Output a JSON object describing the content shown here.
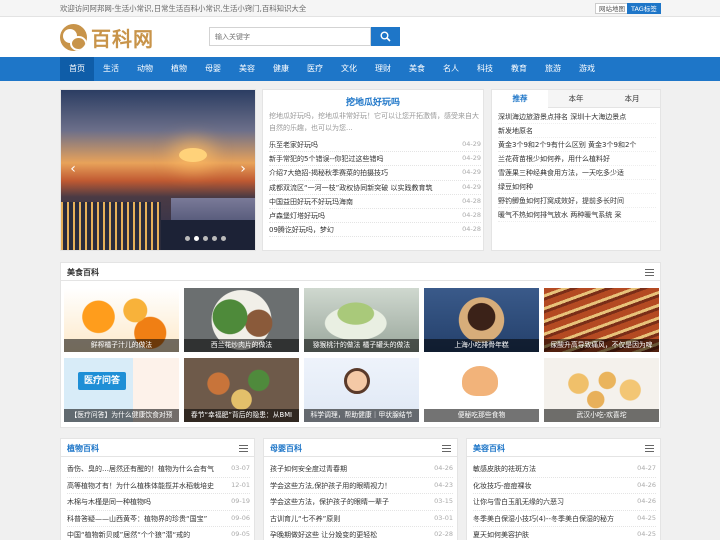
{
  "topbar": {
    "welcome": "欢迎访问阿邦网-生活小常识,日常生活百科小常识,生活小窍门,百科知识大全",
    "sitemap": "网站地图",
    "tags": "TAG标签"
  },
  "header": {
    "logo_text": "百科网",
    "search_placeholder": "输入关键字"
  },
  "nav": [
    "首页",
    "生活",
    "动物",
    "植物",
    "母婴",
    "美容",
    "健康",
    "医疗",
    "文化",
    "理财",
    "美食",
    "名人",
    "科技",
    "教育",
    "旅游",
    "游戏"
  ],
  "headline": {
    "title": "挖地瓜好玩吗",
    "desc": "挖地瓜好玩吗，挖地瓜非常好玩！它可以让您开拓激情，感受来自大自然的乐趣，也可以为您...",
    "items": [
      {
        "title": "乐至老家好玩吗",
        "date": "04-29"
      },
      {
        "title": "新手常犯的5个错误--你犯过这些错吗",
        "date": "04-29"
      },
      {
        "title": "介绍7大绝招-揭秘秋季赛菜的拍摄技巧",
        "date": "04-29"
      },
      {
        "title": "成都双流区“一河一枝”政权协同新突破 以实践教育筑",
        "date": "04-29"
      },
      {
        "title": "中国益田好玩不好玩玛海南",
        "date": "04-28"
      },
      {
        "title": "卢森堡灯塔好玩吗",
        "date": "04-28"
      },
      {
        "title": "09腾讫好玩吗，梦幻",
        "date": "04-28"
      }
    ]
  },
  "rank": {
    "tabs": [
      "推荐",
      "本年",
      "本月"
    ],
    "items": [
      "深圳海边旅游景点排名 深圳十大海边景点",
      "新发地原名",
      "黄金3个9和2个9有什么区别 黄金3个9和2个",
      "兰花荷苗根少如何养，用什么植料好",
      "雪莲果三种经典食用方法，一天吃多少适",
      "绿豆如何种",
      "野钓鲫鱼如何打窝成效好，提前多长时间",
      "暖气不热如何排气放水 两种暖气系统 采"
    ]
  },
  "food": {
    "title": "美食百科",
    "row1": [
      "鲜榨橘子汁儿的做法",
      "西兰花炒肉片的做法",
      "猕猴桃汁的做法 橘子罐头的做法",
      "上海小吃排骨年糕",
      "尿酸升高导致痛风，不仅是因为啤"
    ],
    "row2": [
      "【医疗问答】为什么健康饮食对预",
      "春节“幸福肥”背后的隐患：从BMI",
      "科学调理，帮助健康｜甲状腺结节",
      "便秘吃那些食物",
      "武汉小吃-欢喜坨"
    ]
  },
  "columns": [
    {
      "title": "植物百科",
      "items": [
        {
          "title": "香伤、臭的…居然还有醒的！植物为什么会有气",
          "date": "03-07"
        },
        {
          "title": "高等植物才有！为什么植株体能揽并水稻栽培史",
          "date": "12-01"
        },
        {
          "title": "木棉与木槿是同一种植物吗",
          "date": "09-19"
        },
        {
          "title": "科普答疑——山西黄芩：植物界的珍贵“国宝”",
          "date": "09-06"
        },
        {
          "title": "中国“植物新贝威”居然“个个狼”潜“戒的",
          "date": "09-05"
        }
      ]
    },
    {
      "title": "母婴百科",
      "items": [
        {
          "title": "孩子如何安全度过青春期",
          "date": "04-26"
        },
        {
          "title": "学会这些方法,保护孩子用的眼睛视力！",
          "date": "04-23"
        },
        {
          "title": "学会这些方法，保护孩子的眼睛一辈子",
          "date": "03-15"
        },
        {
          "title": "古训育儿“七不养”原则",
          "date": "03-01"
        },
        {
          "title": "孕晚期做好这些 让分娩变的更轻松",
          "date": "02-28"
        }
      ]
    },
    {
      "title": "美容百科",
      "items": [
        {
          "title": "敏感皮肤的祛斑方法",
          "date": "04-27"
        },
        {
          "title": "化妆技巧-痘痘裸妆",
          "date": "04-26"
        },
        {
          "title": "让你与雪白玉肌无缘的六恶习",
          "date": "04-26"
        },
        {
          "title": "冬季美白保湿小技巧(4)--冬季美白保湿的秘方",
          "date": "04-25"
        },
        {
          "title": "夏天如何美容护肤",
          "date": "04-25"
        }
      ]
    }
  ]
}
